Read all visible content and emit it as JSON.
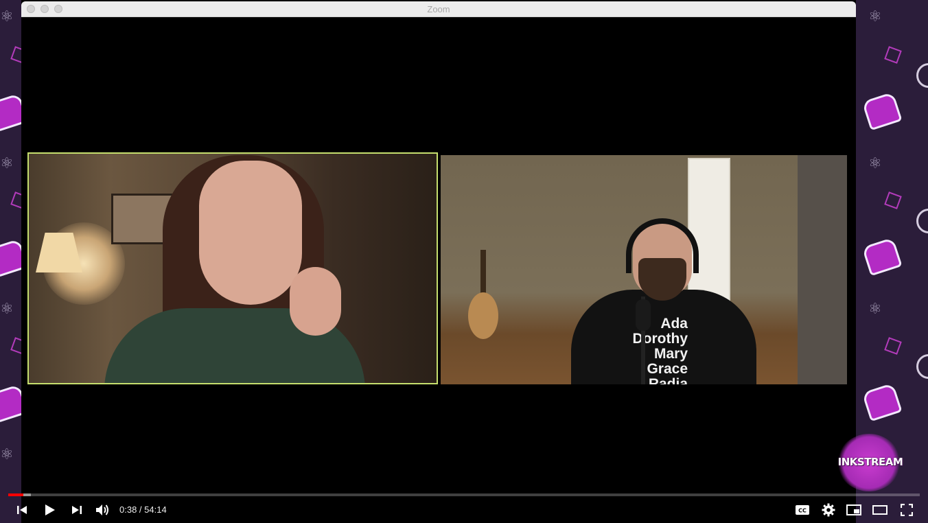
{
  "window": {
    "title": "Zoom"
  },
  "participants": [
    {
      "name": "",
      "active_speaker": true
    },
    {
      "name": "",
      "active_speaker": false
    }
  ],
  "shirt_text": [
    "Ada",
    "Dorothy",
    "Mary",
    "Grace",
    "Radia"
  ],
  "overlay_logo": "INKSTREAM",
  "player": {
    "current_time": "0:38",
    "separator": " / ",
    "duration": "54:14",
    "progress_fraction": 0.0117,
    "buffer_fraction": 0.025,
    "accent_color": "#ff0000",
    "controls": {
      "prev": "skip-previous-icon",
      "play": "play-icon",
      "next": "skip-next-icon",
      "volume": "volume-icon",
      "captions": "closed-captions-icon",
      "settings": "gear-icon",
      "miniplayer": "miniplayer-icon",
      "theater": "theater-mode-icon",
      "fullscreen": "fullscreen-icon"
    }
  },
  "colors": {
    "active_speaker_border": "#c6df6e",
    "side_panel": "#2b1d3a",
    "decor_accent": "#b32bc4"
  }
}
